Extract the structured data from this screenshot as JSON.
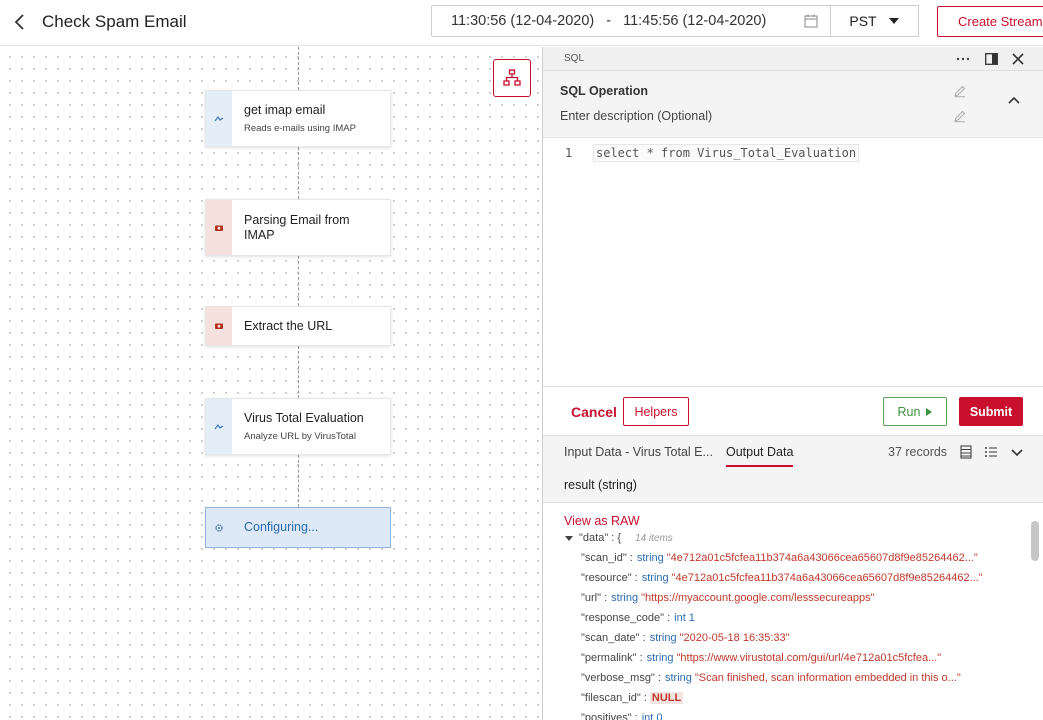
{
  "header": {
    "title": "Check Spam Email",
    "time_start": "11:30:56 (12-04-2020)",
    "time_separator": "-",
    "time_end": "11:45:56 (12-04-2020)",
    "timezone": "PST",
    "create_stream_label": "Create Stream"
  },
  "canvas": {
    "nodes": [
      {
        "name": "get imap email",
        "desc": "Reads e-mails using IMAP",
        "icon": "connector-icon"
      },
      {
        "name": "Parsing Email from IMAP",
        "desc": "",
        "icon": "function-icon"
      },
      {
        "name": "Extract the URL",
        "desc": "",
        "icon": "function-icon"
      },
      {
        "name": "Virus Total Evaluation",
        "desc": "Analyze URL by VirusTotal",
        "icon": "connector-icon"
      },
      {
        "name": "Configuring...",
        "desc": "",
        "icon": "gear-icon"
      }
    ]
  },
  "panel": {
    "bar_label": "SQL",
    "op_title": "SQL Operation",
    "op_desc": "Enter description (Optional)",
    "line_number": "1",
    "code": "select * from Virus_Total_Evaluation",
    "cancel_label": "Cancel",
    "helpers_label": "Helpers",
    "run_label": "Run",
    "submit_label": "Submit",
    "tab_input": "Input Data - Virus Total E...",
    "tab_output": "Output Data",
    "records": "37 records",
    "result_header": "result (string)",
    "view_raw": "View as RAW"
  },
  "json_view": {
    "root_key": "\"data\"",
    "root_open": ": {",
    "root_count": "14 items",
    "fields": [
      {
        "key": "\"scan_id\"",
        "type": "string",
        "value": "\"4e712a01c5fcfea11b374a6a43066cea65607d8f9e85264462...\""
      },
      {
        "key": "\"resource\"",
        "type": "string",
        "value": "\"4e712a01c5fcfea11b374a6a43066cea65607d8f9e85264462...\""
      },
      {
        "key": "\"url\"",
        "type": "string",
        "value": "\"https://myaccount.google.com/lesssecureapps\""
      },
      {
        "key": "\"response_code\"",
        "type": "int",
        "value": "1"
      },
      {
        "key": "\"scan_date\"",
        "type": "string",
        "value": "\"2020-05-18 16:35:33\""
      },
      {
        "key": "\"permalink\"",
        "type": "string",
        "value": "\"https://www.virustotal.com/gui/url/4e712a01c5fcfea...\""
      },
      {
        "key": "\"verbose_msg\"",
        "type": "string",
        "value": "\"Scan finished, scan information embedded in this o...\""
      },
      {
        "key": "\"filescan_id\"",
        "type": "",
        "value": "NULL"
      },
      {
        "key": "\"positives\"",
        "type": "int",
        "value": "0"
      }
    ]
  },
  "colors": {
    "accent": "#c8102e",
    "run_green": "#3c8f3c",
    "link_blue": "#2b6cb0"
  }
}
